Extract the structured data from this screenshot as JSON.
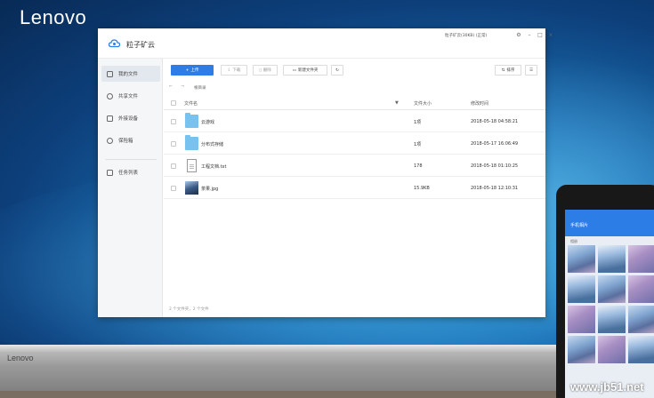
{
  "brand": "Lenovo",
  "base_logo": "Lenovo",
  "window": {
    "title": "粒子矿云",
    "user_info": "粒子矿云(30KB) (正常)",
    "controls": [
      "gear-icon",
      "minimize-icon",
      "maximize-icon",
      "close-icon"
    ]
  },
  "sidebar": {
    "items": [
      {
        "label": "我的文件",
        "active": true
      },
      {
        "label": "共享文件",
        "active": false
      },
      {
        "label": "外接设备",
        "active": false
      },
      {
        "label": "保险箱",
        "active": false
      },
      {
        "label": "任务列表",
        "active": false
      }
    ]
  },
  "toolbar": {
    "upload": "上传",
    "download": "下载",
    "delete": "删除",
    "new_folder": "新建文件夹",
    "refresh": "↻",
    "sort": "排序"
  },
  "nav": {
    "back": "←",
    "forward": "→",
    "breadcrumb": "根目录"
  },
  "table": {
    "headers": {
      "name": "文件名",
      "size": "文件大小",
      "date": "修改时间"
    },
    "rows": [
      {
        "name": "云游戏",
        "size": "1项",
        "date": "2018-05-18 04:58:21",
        "icon": "folder"
      },
      {
        "name": "分布式存储",
        "size": "1项",
        "date": "2018-05-17 16:06:49",
        "icon": "folder"
      },
      {
        "name": "工程文档.txt",
        "size": "178",
        "date": "2018-05-18 01:10:25",
        "icon": "doc"
      },
      {
        "name": "茶果.jpg",
        "size": "15.9KB",
        "date": "2018-05-18 12:10:31",
        "icon": "image"
      }
    ]
  },
  "footer": "2 个文件夹，2 个文件",
  "phone": {
    "title": "手机相片",
    "sub": "相册"
  },
  "watermark": "www.jb51.net"
}
